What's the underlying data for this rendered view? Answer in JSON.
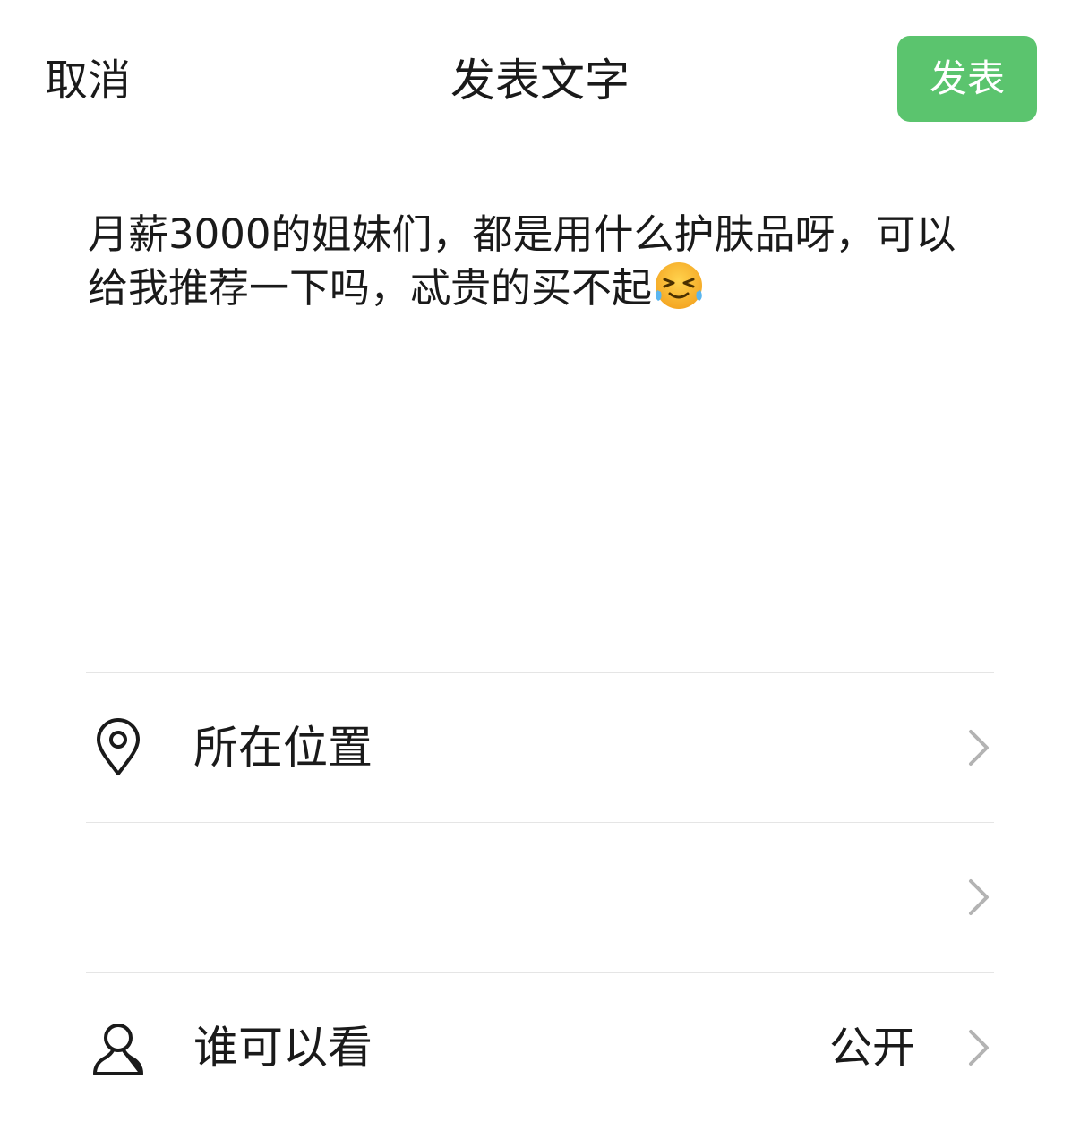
{
  "header": {
    "cancel_label": "取消",
    "title": "发表文字",
    "publish_label": "发表"
  },
  "post": {
    "text": "月薪3000的姐妹们，都是用什么护肤品呀，可以给我推荐一下吗，忒贵的买不起",
    "emoji": "crying-laughing-face-icon"
  },
  "options": [
    {
      "icon": "location-pin-icon",
      "label": "所在位置",
      "value": ""
    },
    {
      "icon": "",
      "label": "",
      "value": ""
    },
    {
      "icon": "person-icon",
      "label": "谁可以看",
      "value": "公开"
    }
  ],
  "colors": {
    "accent": "#5bc46e",
    "divider": "#e5e5e5",
    "chevron": "#b3b3b3",
    "text": "#1a1a1a"
  }
}
